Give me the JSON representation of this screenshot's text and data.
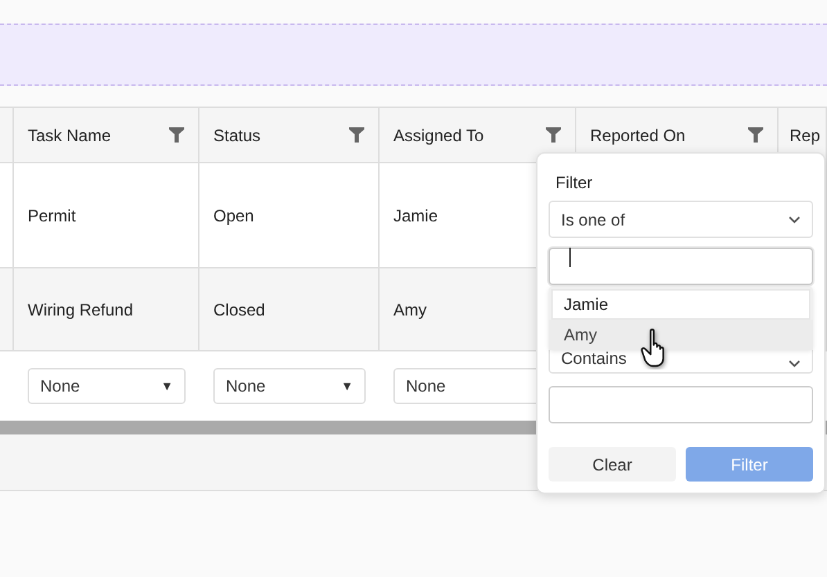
{
  "columns": [
    {
      "label": "Task Name",
      "filterable": true
    },
    {
      "label": "Status",
      "filterable": true
    },
    {
      "label": "Assigned To",
      "filterable": true
    },
    {
      "label": "Reported On",
      "filterable": true
    },
    {
      "label": "Rep",
      "filterable": false
    }
  ],
  "rows": [
    {
      "cells": [
        "Permit",
        "Open",
        "Jamie"
      ]
    },
    {
      "cells": [
        "Wiring Refund",
        "Closed",
        "Amy"
      ]
    }
  ],
  "filter_row": [
    {
      "value": "None",
      "caret": "▼"
    },
    {
      "value": "None",
      "caret": "▼"
    },
    {
      "value": "None"
    }
  ],
  "filter_popup": {
    "label": "Filter",
    "operator": "Is one of",
    "options": [
      {
        "label": "Jamie",
        "hovered": false
      },
      {
        "label": "Amy",
        "hovered": true
      }
    ],
    "operator_2": "Contains",
    "buttons": [
      {
        "label": "Clear",
        "kind": "secondary"
      },
      {
        "label": "Filter",
        "kind": "primary"
      }
    ]
  }
}
